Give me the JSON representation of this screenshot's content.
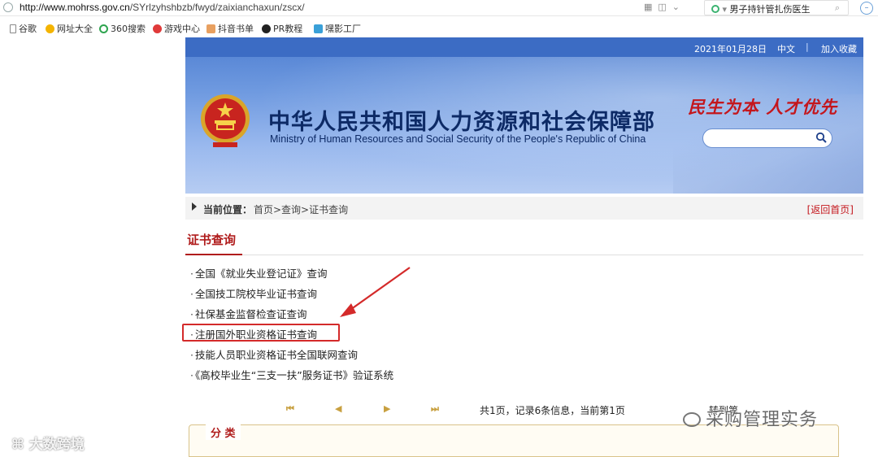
{
  "browser": {
    "url_prefix": "http://www.mohrss.gov.cn",
    "url_path": "/SYrlzyhshbzb/fwyd/zaixianchaxun/zscx/",
    "search_text": "男子持针管扎伤医生",
    "bookmarks": [
      "谷歌",
      "网址大全",
      "360搜索",
      "游戏中心",
      "抖音书单",
      "PR教程",
      "嘿影工厂"
    ]
  },
  "header": {
    "date": "2021年01月28日",
    "lang": "中文",
    "separator": "|",
    "favorite": "加入收藏",
    "title_cn": "中华人民共和国人力资源和社会保障部",
    "title_en": "Ministry of Human Resources and Social Security of the People's Republic of China",
    "slogan": "民生为本 人才优先"
  },
  "breadcrumb": {
    "label": "当前位置：",
    "path": "首页>查询>证书查询",
    "back": "[返回首页]"
  },
  "section": {
    "title": "证书查询",
    "items": [
      "全国《就业失业登记证》查询",
      "全国技工院校毕业证书查询",
      "社保基金监督检查证查询",
      "注册国外职业资格证书查询",
      "技能人员职业资格证书全国联网查询",
      "《高校毕业生“三支一扶”服务证书》验证系统"
    ],
    "highlighted_index": 3
  },
  "pager": {
    "first": "⏮",
    "prev": "◀",
    "next": "▶",
    "last": "⏭",
    "info": "共1页，记录6条信息，当前第1页",
    "jump": "转到第"
  },
  "category": {
    "label": "分 类"
  },
  "watermarks": {
    "left": "大数跨境",
    "right": "采购管理实务"
  },
  "colors": {
    "brand_blue": "#3c6cc4",
    "accent_red": "#b01c1c",
    "highlight_red": "#d42a2a"
  }
}
